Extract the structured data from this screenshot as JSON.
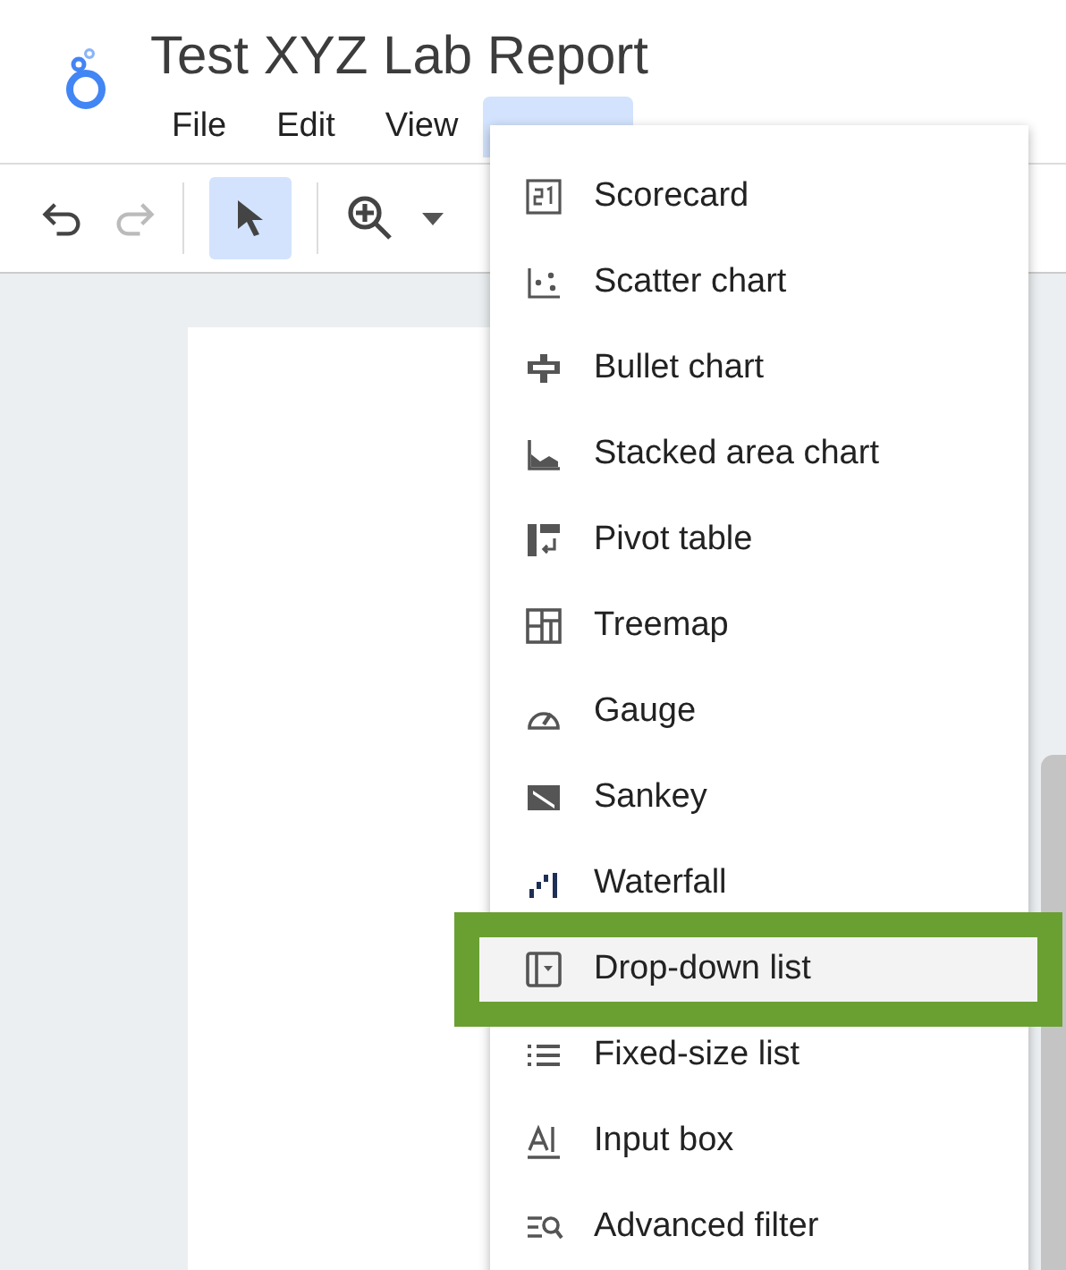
{
  "title": "Test XYZ Lab Report",
  "menubar": [
    {
      "label": "File",
      "selected": false
    },
    {
      "label": "Edit",
      "selected": false
    },
    {
      "label": "View",
      "selected": false
    }
  ],
  "open_menu_tab": {
    "selected": true
  },
  "toolbar": {
    "select_active": true
  },
  "insert_menu": [
    {
      "label": "Scorecard",
      "selected": false
    },
    {
      "label": "Scatter chart",
      "selected": false
    },
    {
      "label": "Bullet chart",
      "selected": false
    },
    {
      "label": "Stacked area chart",
      "selected": false
    },
    {
      "label": "Pivot table",
      "selected": false
    },
    {
      "label": "Treemap",
      "selected": false
    },
    {
      "label": "Gauge",
      "selected": false
    },
    {
      "label": "Sankey",
      "selected": false
    },
    {
      "label": "Waterfall",
      "selected": false
    },
    {
      "label": "Drop-down list",
      "selected": true
    },
    {
      "label": "Fixed-size list",
      "selected": false
    },
    {
      "label": "Input box",
      "selected": false
    },
    {
      "label": "Advanced filter",
      "selected": false
    }
  ]
}
